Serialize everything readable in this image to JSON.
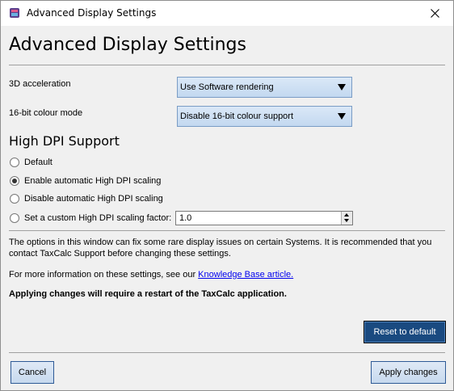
{
  "window": {
    "title": "Advanced Display Settings",
    "icon": "taxcalc-app-icon",
    "close_icon": "close-icon"
  },
  "heading": "Advanced Display Settings",
  "acceleration": {
    "label": "3D acceleration",
    "value": "Use Software rendering"
  },
  "colour_mode": {
    "label": "16-bit colour mode",
    "value": "Disable 16-bit colour support"
  },
  "dpi": {
    "heading": "High DPI Support",
    "options": [
      {
        "label": "Default",
        "checked": false
      },
      {
        "label": "Enable automatic High DPI scaling",
        "checked": true
      },
      {
        "label": "Disable automatic High DPI scaling",
        "checked": false
      },
      {
        "label": "Set a custom High DPI scaling factor:",
        "checked": false
      }
    ],
    "factor_value": "1.0"
  },
  "info": {
    "text": "The options in this window can fix some rare display issues on certain Systems. It is recommended that you contact TaxCalc Support before changing these settings.",
    "more_prefix": "For more information on these settings, see our ",
    "link_text": "Knowledge Base article.",
    "restart_note": "Applying changes will require a restart of the TaxCalc application."
  },
  "buttons": {
    "reset": "Reset to default",
    "cancel": "Cancel",
    "apply": "Apply changes"
  },
  "colors": {
    "accent": "#1a4a80",
    "link": "#0000ee",
    "combo_border": "#7a9cc5"
  }
}
